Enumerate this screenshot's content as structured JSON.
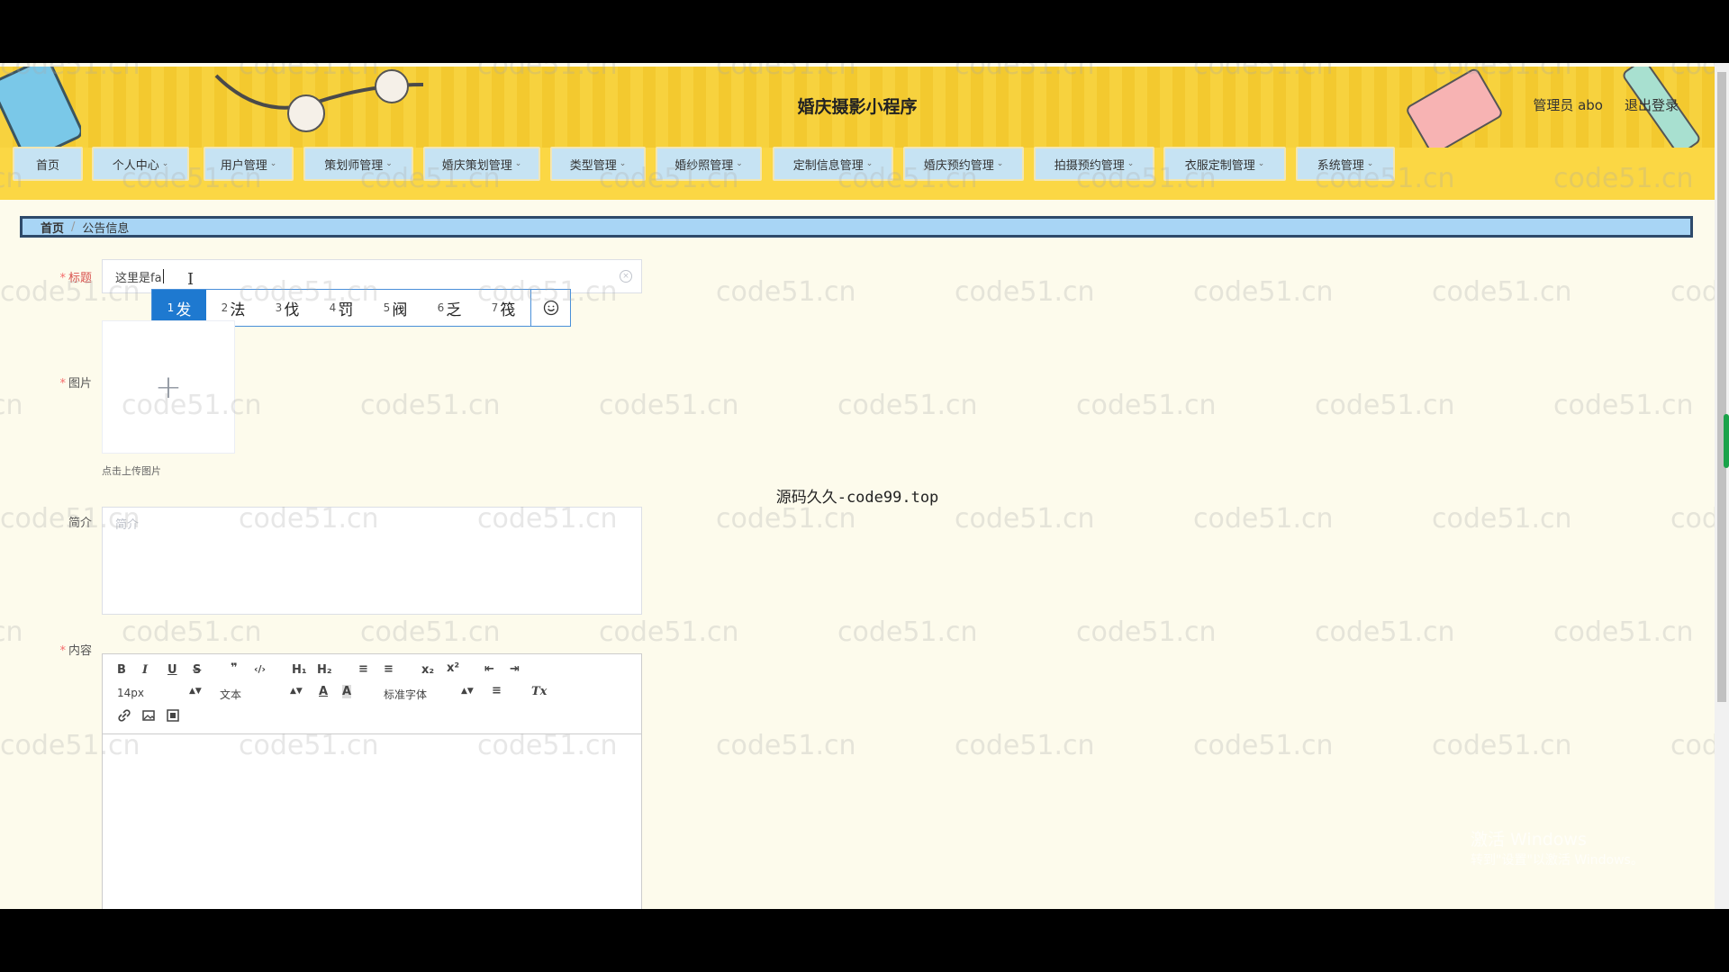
{
  "header": {
    "title": "婚庆摄影小程序",
    "admin_label": "管理员 abo",
    "logout_label": "退出登录"
  },
  "nav": {
    "items": [
      {
        "label": "首页",
        "has_dropdown": false
      },
      {
        "label": "个人中心",
        "has_dropdown": true
      },
      {
        "label": "用户管理",
        "has_dropdown": true
      },
      {
        "label": "策划师管理",
        "has_dropdown": true
      },
      {
        "label": "婚庆策划管理",
        "has_dropdown": true
      },
      {
        "label": "类型管理",
        "has_dropdown": true
      },
      {
        "label": "婚纱照管理",
        "has_dropdown": true
      },
      {
        "label": "定制信息管理",
        "has_dropdown": true
      },
      {
        "label": "婚庆预约管理",
        "has_dropdown": true
      },
      {
        "label": "拍摄预约管理",
        "has_dropdown": true
      },
      {
        "label": "衣服定制管理",
        "has_dropdown": true
      },
      {
        "label": "系统管理",
        "has_dropdown": true
      }
    ]
  },
  "breadcrumb": {
    "home": "首页",
    "current": "公告信息"
  },
  "form": {
    "title_label": "标题",
    "title_value": "这里是fa",
    "image_label": "图片",
    "upload_tip": "点击上传图片",
    "intro_label": "简介",
    "intro_placeholder": "简介",
    "content_label": "内容"
  },
  "ime": {
    "candidates": [
      {
        "num": "1",
        "char": "发"
      },
      {
        "num": "2",
        "char": "法"
      },
      {
        "num": "3",
        "char": "伐"
      },
      {
        "num": "4",
        "char": "罚"
      },
      {
        "num": "5",
        "char": "阀"
      },
      {
        "num": "6",
        "char": "乏"
      },
      {
        "num": "7",
        "char": "筏"
      }
    ],
    "selected_index": 0
  },
  "editor": {
    "font_size": "14px",
    "text_type": "文本",
    "font_family": "标准字体",
    "row1_labels": {
      "bold": "B",
      "italic": "I",
      "underline": "U",
      "strike": "S",
      "quote": "❞",
      "code": "‹/›",
      "h1": "H₁",
      "h2": "H₂",
      "ol": "≡",
      "ul": "≡",
      "sub": "x₂",
      "sup": "x²",
      "outdent": "⇤",
      "indent": "⇥"
    },
    "row2_labels": {
      "color": "A",
      "bg": "A",
      "align": "≡",
      "clean": "Tx"
    }
  },
  "overlay_text": "源码久久-code99.top",
  "watermark_text": "code51.cn",
  "activation": {
    "line1": "激活 Windows",
    "line2": "转到\"设置\"以激活 Windows。"
  },
  "colors": {
    "header_yellow": "#f7d23e",
    "nav_item_bg": "#c6e3f3",
    "breadcrumb_bg": "#a8d5f5",
    "ime_selected": "#1e79d0",
    "page_bg": "#fdfbec"
  }
}
